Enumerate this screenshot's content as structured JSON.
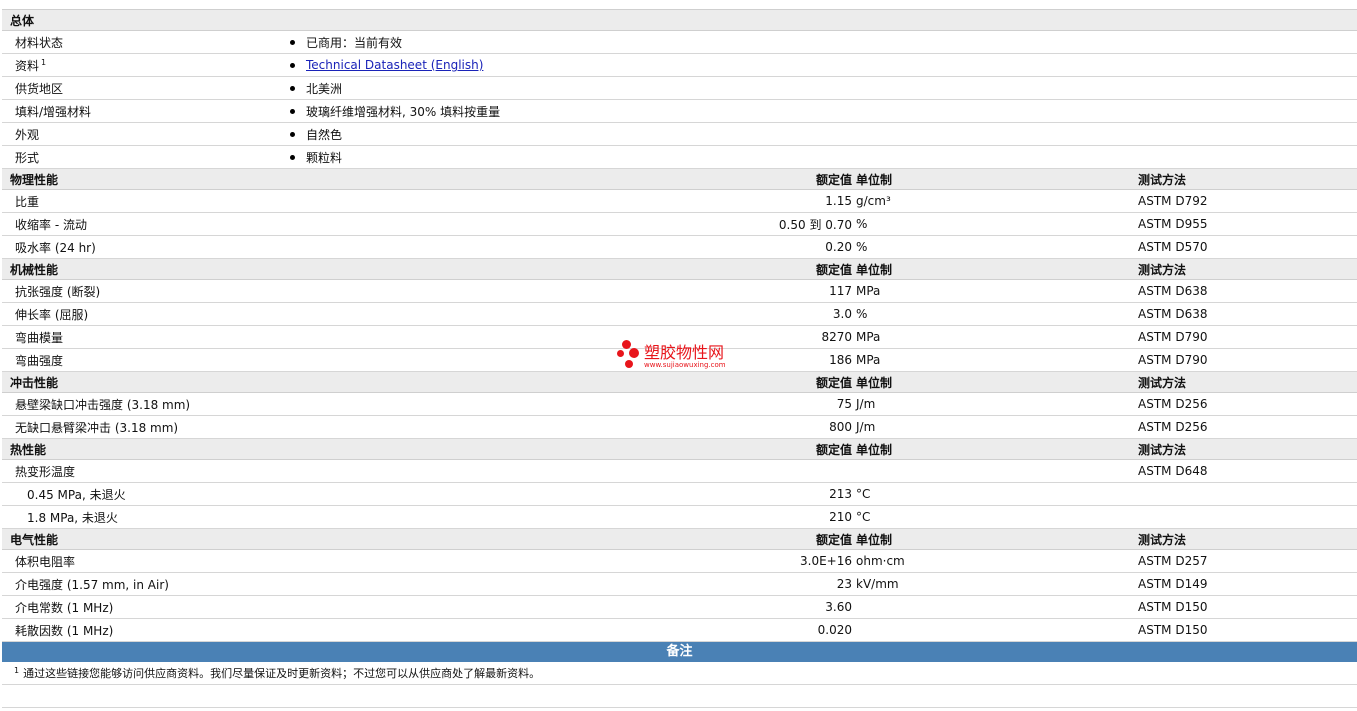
{
  "general": {
    "title": "总体",
    "rows": [
      {
        "label": "材料状态",
        "value": "已商用：当前有效"
      },
      {
        "label": "资料",
        "sup": "1",
        "value": "Technical Datasheet (English)",
        "link": true
      },
      {
        "label": "供货地区",
        "value": "北美洲"
      },
      {
        "label": "填料/增强材料",
        "value": "玻璃纤维增强材料, 30% 填料按重量"
      },
      {
        "label": "外观",
        "value": "自然色"
      },
      {
        "label": "形式",
        "value": "颗粒料"
      }
    ]
  },
  "headers": {
    "value": "额定值",
    "unit": "单位制",
    "test": "测试方法"
  },
  "sections": [
    {
      "title": "物理性能",
      "rows": [
        {
          "label": "比重",
          "value": "1.15",
          "unit": "g/cm³",
          "test": "ASTM D792"
        },
        {
          "label": "收缩率 - 流动",
          "value": "0.50 到  0.70",
          "unit": "%",
          "test": "ASTM D955"
        },
        {
          "label": "吸水率 (24 hr)",
          "value": "0.20",
          "unit": "%",
          "test": "ASTM D570"
        }
      ]
    },
    {
      "title": "机械性能",
      "rows": [
        {
          "label": "抗张强度 (断裂)",
          "value": "117",
          "unit": "MPa",
          "test": "ASTM D638"
        },
        {
          "label": "伸长率 (屈服)",
          "value": "3.0",
          "unit": "%",
          "test": "ASTM D638"
        },
        {
          "label": "弯曲模量",
          "value": "8270",
          "unit": "MPa",
          "test": "ASTM D790"
        },
        {
          "label": "弯曲强度",
          "value": "186",
          "unit": "MPa",
          "test": "ASTM D790"
        }
      ]
    },
    {
      "title": "冲击性能",
      "rows": [
        {
          "label": "悬壁梁缺口冲击强度 (3.18 mm)",
          "value": "75",
          "unit": "J/m",
          "test": "ASTM D256"
        },
        {
          "label": "无缺口悬臂梁冲击 (3.18 mm)",
          "value": "800",
          "unit": "J/m",
          "test": "ASTM D256"
        }
      ]
    },
    {
      "title": "热性能",
      "rows": [
        {
          "label": "热变形温度",
          "value": "",
          "unit": "",
          "test": "ASTM D648"
        },
        {
          "label": "0.45 MPa, 未退火",
          "sub": true,
          "value": "213",
          "unit": "°C",
          "test": ""
        },
        {
          "label": "1.8 MPa, 未退火",
          "sub": true,
          "value": "210",
          "unit": "°C",
          "test": ""
        }
      ]
    },
    {
      "title": "电气性能",
      "rows": [
        {
          "label": "体积电阻率",
          "value": "3.0E+16",
          "unit": "ohm·cm",
          "test": "ASTM D257"
        },
        {
          "label": "介电强度 (1.57 mm, in Air)",
          "value": "23",
          "unit": "kV/mm",
          "test": "ASTM D149"
        },
        {
          "label": "介电常数 (1 MHz)",
          "value": "3.60",
          "unit": "",
          "test": "ASTM D150"
        },
        {
          "label": "耗散因数 (1 MHz)",
          "value": "0.020",
          "unit": "",
          "test": "ASTM D150"
        }
      ]
    }
  ],
  "notes": {
    "title": "备注",
    "footnote_mark": "1",
    "footnote": "通过这些链接您能够访问供应商资料。我们尽量保证及时更新资料；不过您可以从供应商处了解最新资料。"
  },
  "watermark": {
    "name": "塑胶物性网",
    "url": "www.sujiaowuxing.com"
  },
  "colors": {
    "accent": "#4a81b5",
    "section_bg": "#ececec",
    "watermark": "#e8151b",
    "link": "#1a23b8"
  }
}
